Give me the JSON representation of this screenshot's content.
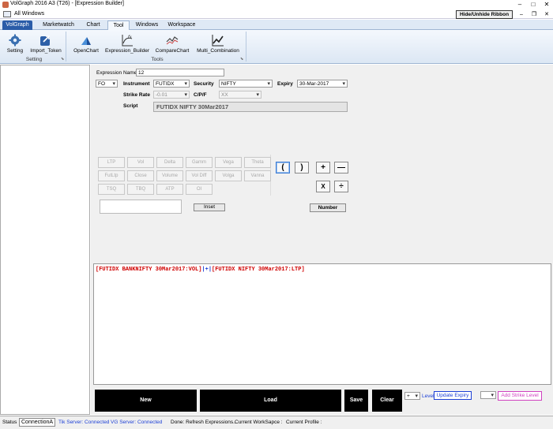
{
  "window": {
    "title": "VolGraph 2016 A3 (T26) - [Expression Builder]",
    "all_windows": "All Windows",
    "hide_ribbon": "Hide/Unhide Ribbon"
  },
  "ribbon": {
    "tabs": [
      "VolGraph",
      "Marketwatch",
      "Chart",
      "Tool",
      "Windows",
      "Workspace"
    ],
    "active_tab": "Tool",
    "groups": [
      {
        "label": "Setting",
        "buttons": [
          {
            "label": "Setting",
            "icon": "gear-icon"
          },
          {
            "label": "Import_Token",
            "icon": "import-icon"
          }
        ]
      },
      {
        "label": "Tools",
        "buttons": [
          {
            "label": "OpenChart",
            "icon": "chart-icon"
          },
          {
            "label": "Expression_Builder",
            "icon": "fx-icon"
          },
          {
            "label": "CompareChart",
            "icon": "compare-chart-icon"
          },
          {
            "label": "Multi_Combination",
            "icon": "multi-chart-icon"
          }
        ]
      }
    ]
  },
  "form": {
    "expression_name_label": "Expression Name",
    "expression_name_value": "12",
    "segment_value": "FO",
    "instrument_label": "Instrument",
    "instrument_value": "FUTIDX",
    "security_label": "Security",
    "security_value": "NIFTY",
    "expiry_label": "Expiry",
    "expiry_value": "30-Mar-2017",
    "strike_rate_label": "Strike Rate",
    "strike_rate_value": "-0.01",
    "cpf_label": "C/P/F",
    "cpf_value": "XX",
    "script_label": "Script",
    "script_value": "FUTIDX  NIFTY  30Mar2017"
  },
  "variables": [
    [
      "LTP",
      "Vol",
      "Delta",
      "Gamm",
      "Vega",
      "Theta"
    ],
    [
      "FutLtp",
      "Close",
      "Volume",
      "Vol Diff",
      "Volga",
      "Vanna"
    ],
    [
      "TSQ",
      "TBQ",
      "ATP",
      "OI"
    ]
  ],
  "operators": {
    "open_paren": "(",
    "close_paren": ")",
    "plus": "+",
    "minus": "—",
    "multiply": "X",
    "divide": "÷"
  },
  "insert_label": "Inset",
  "number_label": "Number",
  "expression": {
    "part1": "[FUTIDX  BANKNIFTY  30Mar2017:VOL]",
    "op": "|+|",
    "part2": "[FUTIDX  NIFTY  30Mar2017:LTP]"
  },
  "bottom": {
    "new_label": "New",
    "load_label": "Load",
    "save_label": "Save",
    "clear_label": "Clear",
    "op_select": "+",
    "level_label": "Level",
    "update_expiry_label": "Update Expiry",
    "add_strike_level_label": "Add Strike Level"
  },
  "status": {
    "status_label": "Status",
    "connection_tab": "ConnectionA",
    "tik_server": "Tik Server: Connected",
    "vg_server": "VG Server: Connected",
    "done_msg": "Done: Refresh Expressions..",
    "workspace": "Current WorkSapce :",
    "profile": "Current Profile :"
  },
  "colors": {
    "expression_text": "#d00000",
    "expression_operator": "#1c3fd6",
    "ribbon_app_tab": "#2a5ca8",
    "server_status": "#1c3fd6",
    "add_strike_border": "#d040c0"
  }
}
